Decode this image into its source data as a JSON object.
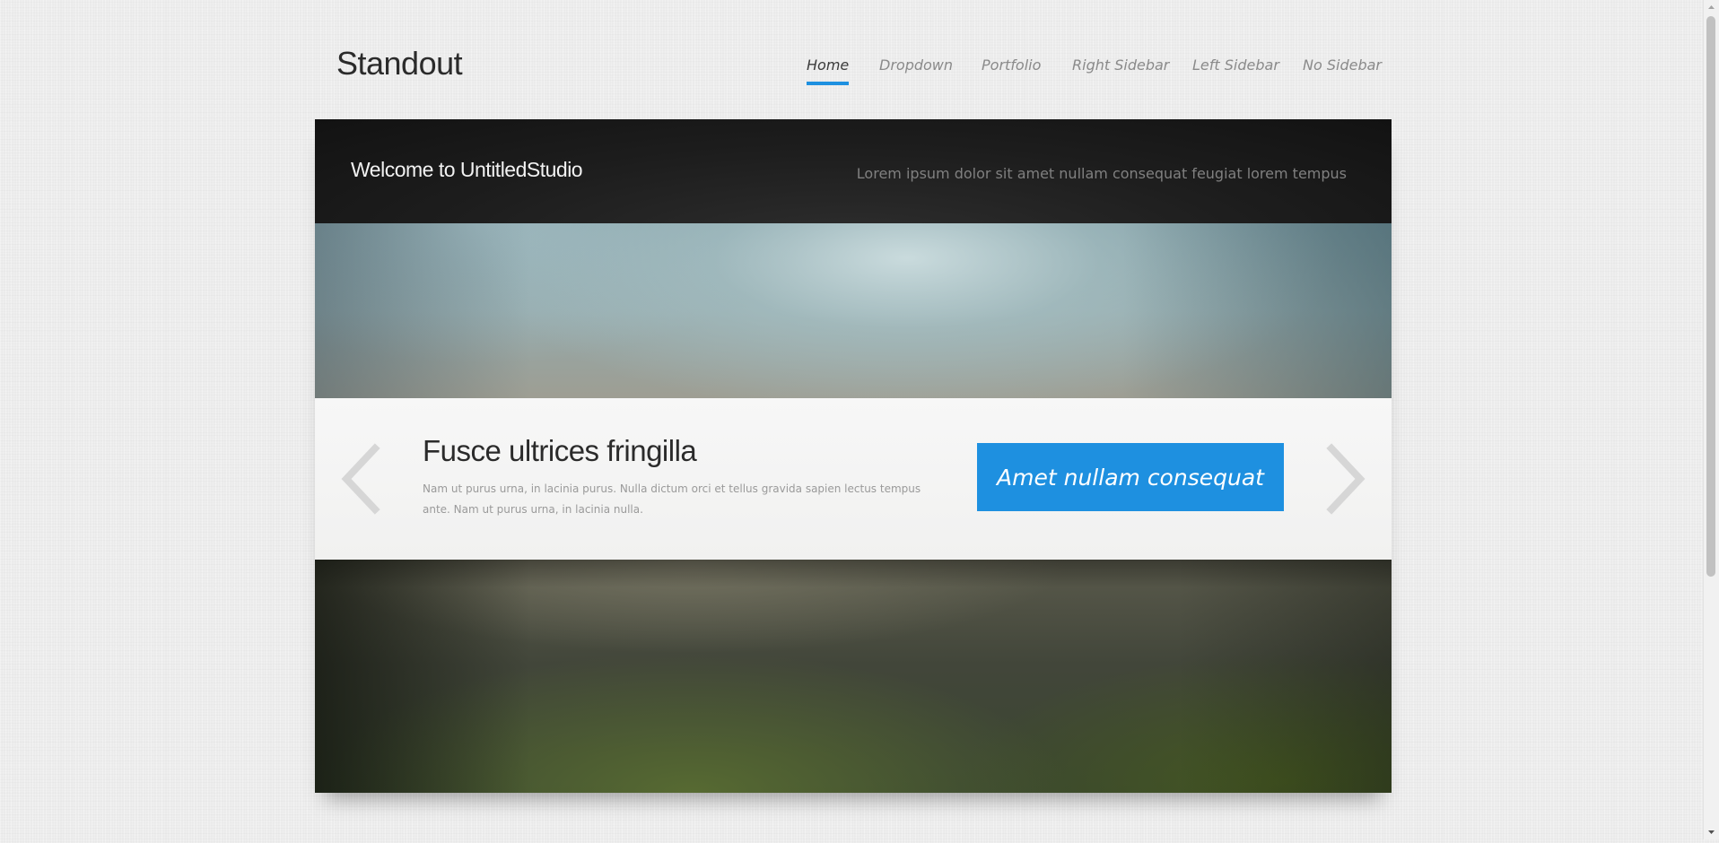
{
  "site": {
    "logo": "Standout"
  },
  "nav": {
    "items": [
      {
        "label": "Home",
        "active": true
      },
      {
        "label": "Dropdown",
        "active": false
      },
      {
        "label": "Portfolio",
        "active": false
      },
      {
        "label": "Right Sidebar",
        "active": false
      },
      {
        "label": "Left Sidebar",
        "active": false
      },
      {
        "label": "No Sidebar",
        "active": false
      }
    ]
  },
  "banner": {
    "title": "Welcome to UntitledStudio",
    "tagline": "Lorem ipsum dolor sit amet nullam consequat feugiat lorem tempus"
  },
  "slide": {
    "title": "Fusce ultrices fringilla",
    "text": "Nam ut purus urna, in lacinia purus. Nulla dictum orci et tellus gravida sapien lectus tempus ante. Nam ut purus urna, in lacinia nulla.",
    "button_label": "Amet nullam consequat",
    "prev_icon": "chevron-left-icon",
    "next_icon": "chevron-right-icon"
  },
  "colors": {
    "accent": "#1e90e0",
    "header_dark": "#1a1a1a",
    "background": "#ececec"
  }
}
